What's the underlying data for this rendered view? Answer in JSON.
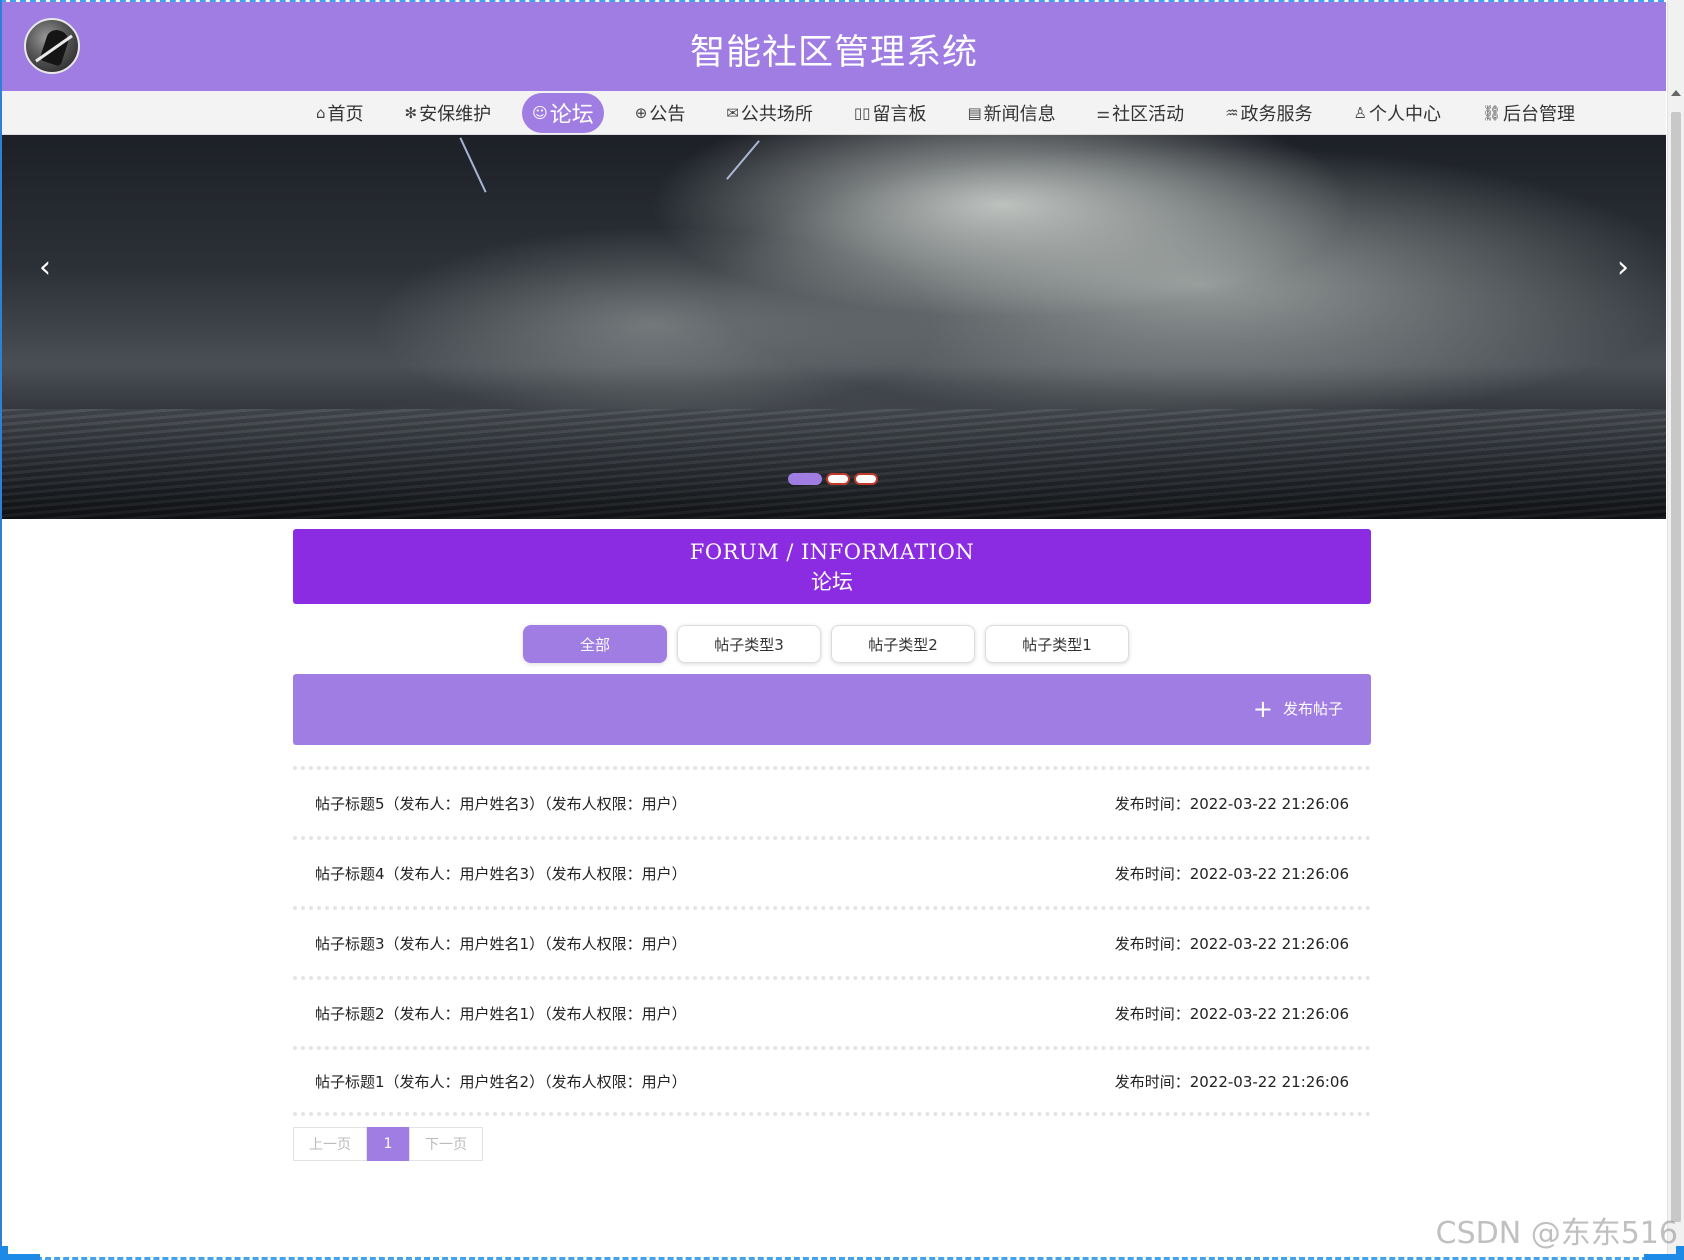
{
  "header": {
    "title": "智能社区管理系统",
    "logo_icon": "silhouette-logo-icon"
  },
  "nav": {
    "items": [
      {
        "label": "首页",
        "icon": "⌂",
        "active": false
      },
      {
        "label": "安保维护",
        "icon": "✻",
        "active": false
      },
      {
        "label": "论坛",
        "icon": "☺",
        "active": true
      },
      {
        "label": "公告",
        "icon": "⊕",
        "active": false
      },
      {
        "label": "公共场所",
        "icon": "✉",
        "active": false
      },
      {
        "label": "留言板",
        "icon": "▯▯",
        "active": false
      },
      {
        "label": "新闻信息",
        "icon": "▤",
        "active": false
      },
      {
        "label": "社区活动",
        "icon": "⚌",
        "active": false
      },
      {
        "label": "政务服务",
        "icon": "♒",
        "active": false
      },
      {
        "label": "个人中心",
        "icon": "♙",
        "active": false
      },
      {
        "label": "后台管理",
        "icon": "⛓",
        "active": false
      }
    ]
  },
  "carousel": {
    "prev_icon": "‹",
    "next_icon": "›",
    "slide_count": 3,
    "active_index": 0
  },
  "section": {
    "title_en": "FORUM / INFORMATION",
    "title_zh": "论坛"
  },
  "filters": [
    {
      "label": "全部",
      "active": true
    },
    {
      "label": "帖子类型3",
      "active": false
    },
    {
      "label": "帖子类型2",
      "active": false
    },
    {
      "label": "帖子类型1",
      "active": false
    }
  ],
  "publish": {
    "label": "发布帖子",
    "icon": "+"
  },
  "posts": [
    {
      "title": "帖子标题5（发布人：用户姓名3）（发布人权限：用户）",
      "time": "发布时间：2022-03-22 21:26:06"
    },
    {
      "title": "帖子标题4（发布人：用户姓名3）（发布人权限：用户）",
      "time": "发布时间：2022-03-22 21:26:06"
    },
    {
      "title": "帖子标题3（发布人：用户姓名1）（发布人权限：用户）",
      "time": "发布时间：2022-03-22 21:26:06"
    },
    {
      "title": "帖子标题2（发布人：用户姓名1）（发布人权限：用户）",
      "time": "发布时间：2022-03-22 21:26:06"
    },
    {
      "title": "帖子标题1（发布人：用户姓名2）（发布人权限：用户）",
      "time": "发布时间：2022-03-22 21:26:06"
    }
  ],
  "pagination": {
    "prev": "上一页",
    "current": "1",
    "next": "下一页"
  },
  "watermark": "CSDN @东东516",
  "colors": {
    "accent": "#a07de3",
    "section_head": "#8b2be2"
  }
}
